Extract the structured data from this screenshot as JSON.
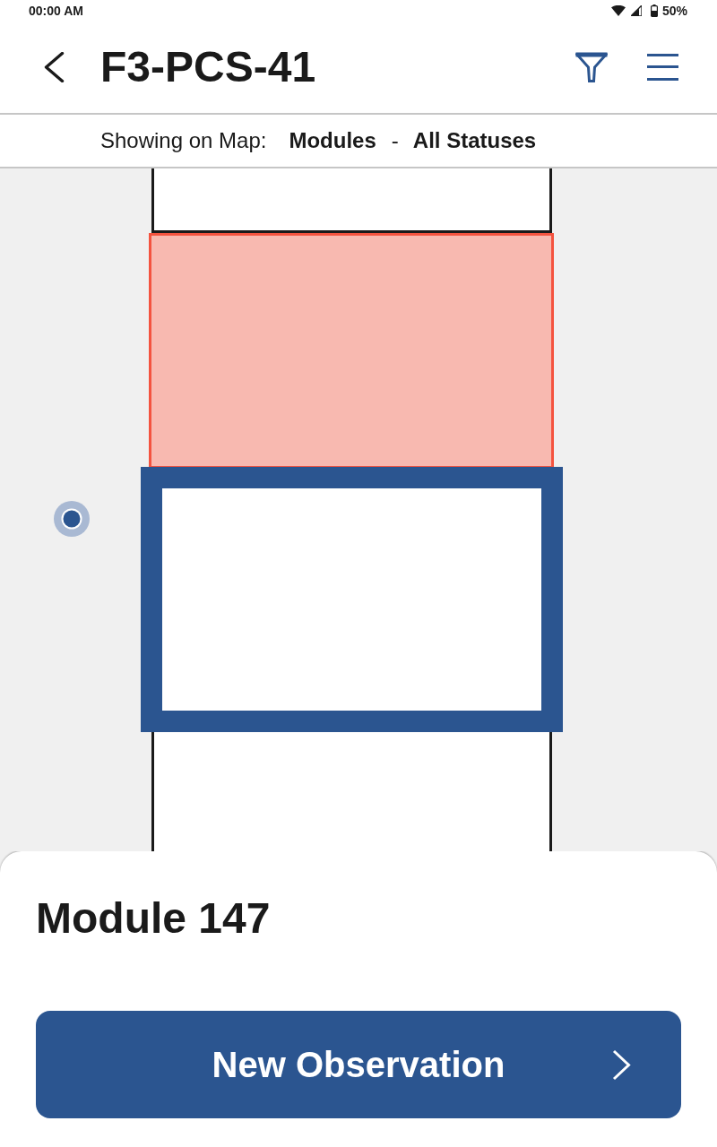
{
  "status_bar": {
    "time": "00:00 AM",
    "battery": "50%"
  },
  "header": {
    "title": "F3-PCS-41"
  },
  "map_filter": {
    "label": "Showing on Map:",
    "layer": "Modules",
    "separator": "-",
    "status": "All Statuses"
  },
  "map": {
    "modules": [
      {
        "kind": "normal",
        "color": "#ffffff",
        "selected": false
      },
      {
        "kind": "flagged",
        "color": "#f8b9b0",
        "selected": false
      },
      {
        "color": "#ffffff",
        "selected": true
      },
      {
        "kind": "normal",
        "color": "#ffffff",
        "selected": false
      }
    ]
  },
  "sheet": {
    "title": "Module 147",
    "action": "New Observation"
  }
}
